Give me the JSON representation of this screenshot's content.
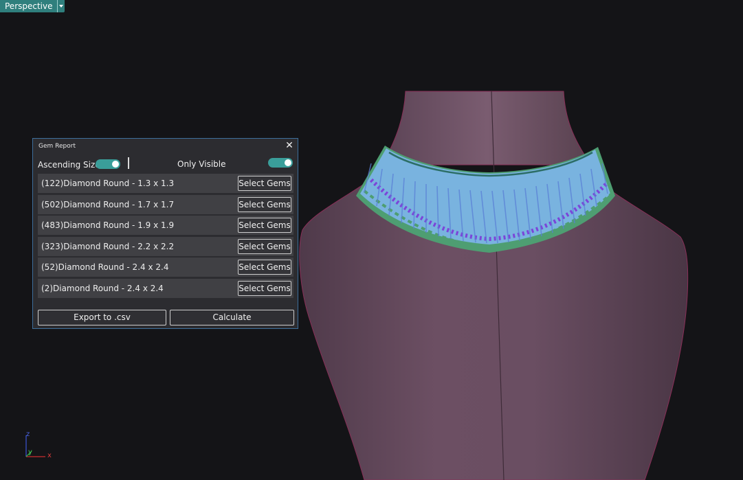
{
  "viewport": {
    "name": "Perspective",
    "axes": {
      "z": "z",
      "y": "y",
      "x": "x"
    }
  },
  "gem_report": {
    "title": "Gem Report",
    "ascending_label": "Ascending Size",
    "ascending_on": true,
    "only_visible_label": "Only Visible",
    "only_visible_on": true,
    "rows": [
      {
        "label": "(122)Diamond Round - 1.3 x 1.3",
        "button": "Select Gems"
      },
      {
        "label": "(502)Diamond Round - 1.7 x 1.7",
        "button": "Select Gems"
      },
      {
        "label": "(483)Diamond Round - 1.9 x 1.9",
        "button": "Select Gems"
      },
      {
        "label": "(323)Diamond Round - 2.2 x 2.2",
        "button": "Select Gems"
      },
      {
        "label": "(52)Diamond Round - 2.4 x 2.4",
        "button": "Select Gems"
      },
      {
        "label": "(2)Diamond Round - 2.4 x 2.4",
        "button": "Select Gems"
      }
    ],
    "export_label": "Export to .csv",
    "calculate_label": "Calculate"
  },
  "colors": {
    "accent": "#2f7f7d",
    "toggle": "#3a9e9a",
    "panel_border": "#3d6f9c",
    "bust": "#6b4d61",
    "gem_light": "#79b3df",
    "gem_purple": "#7b45d9",
    "gem_green": "#4e9e72"
  }
}
